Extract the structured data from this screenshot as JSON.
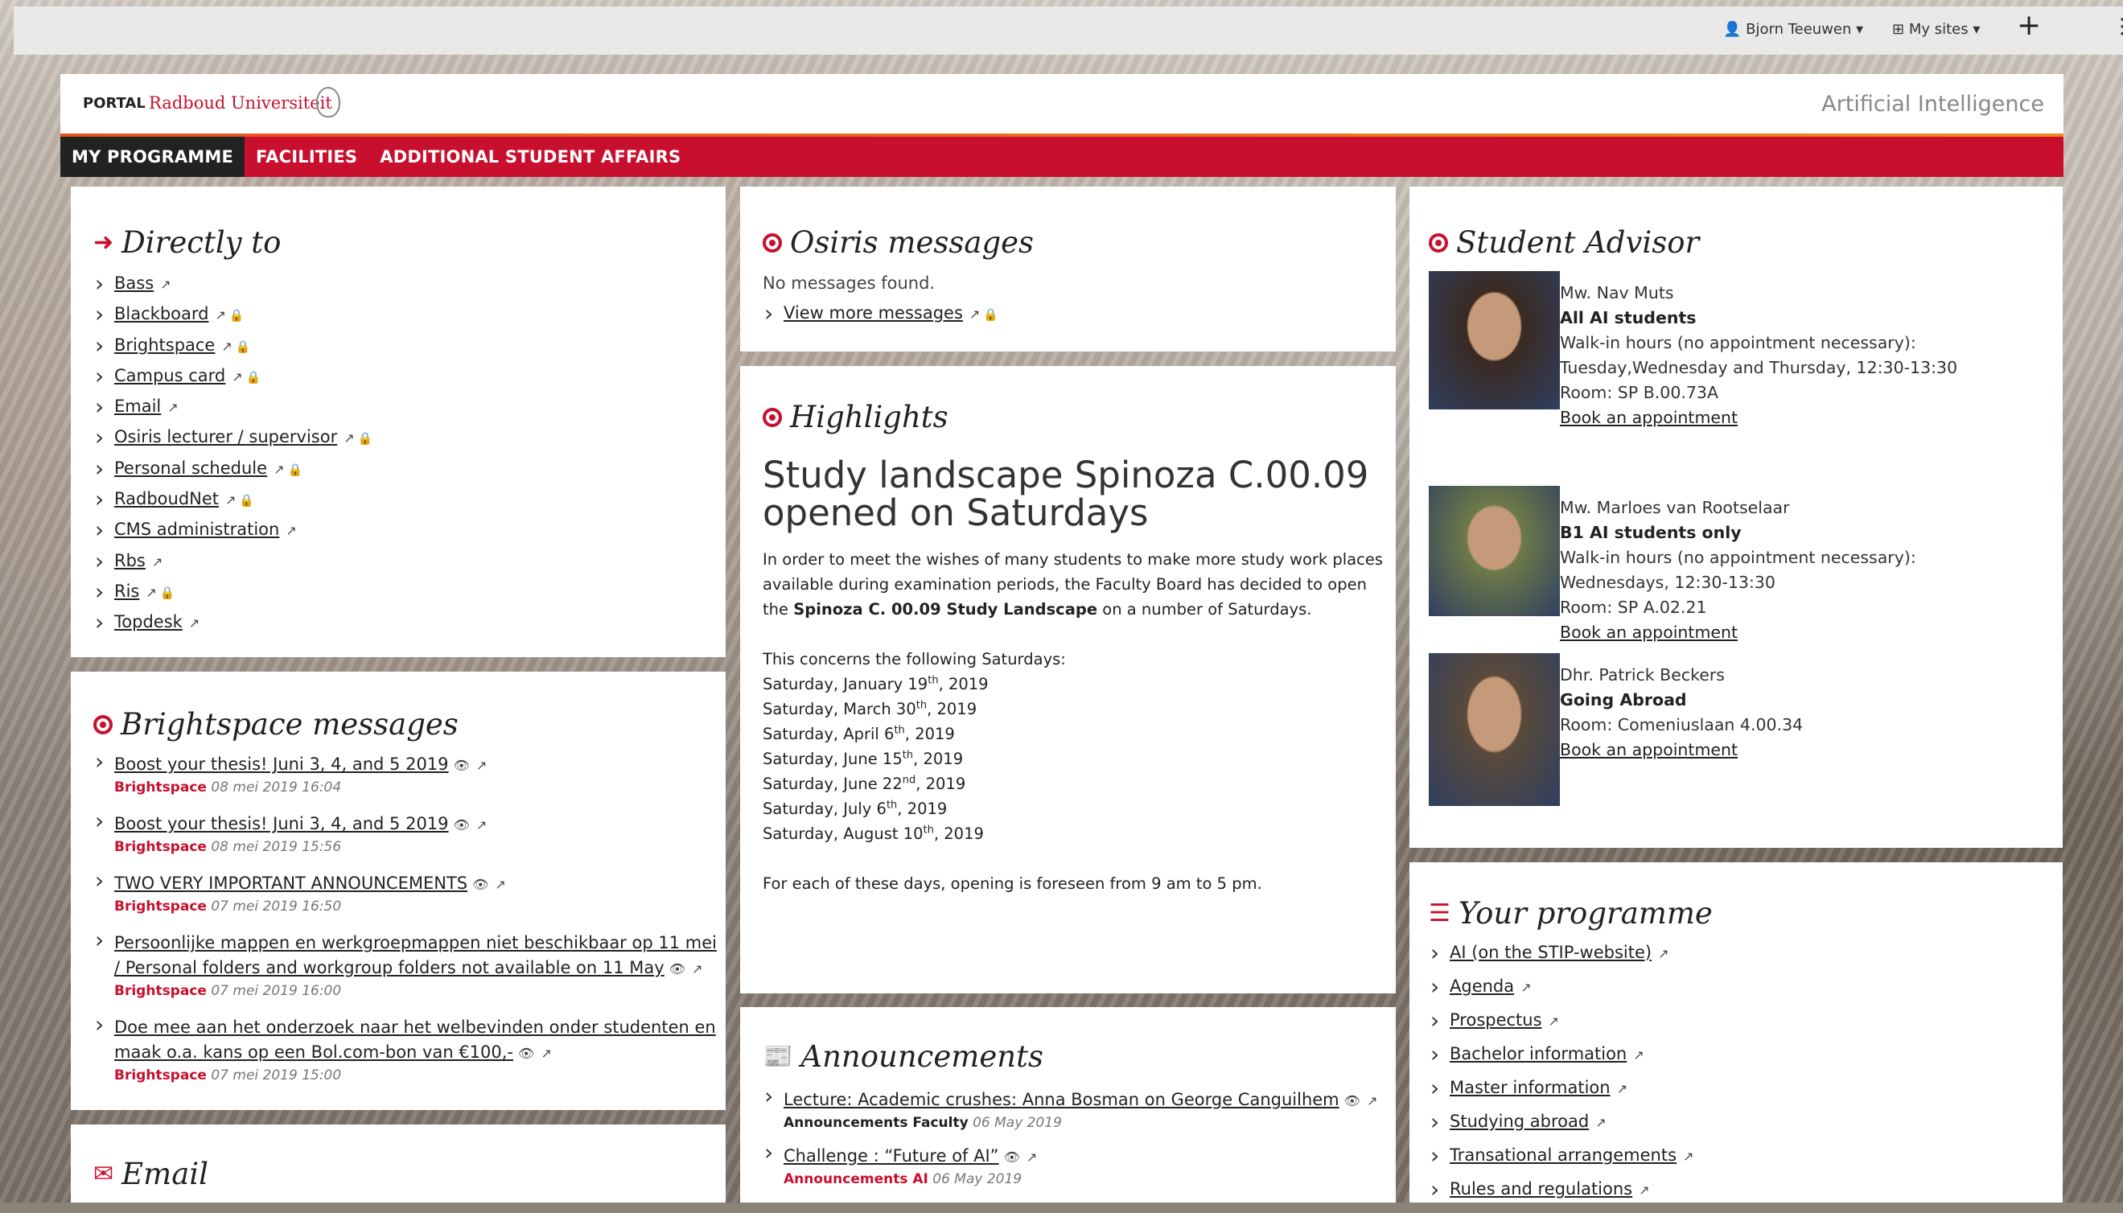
{
  "topbar": {
    "user": "Bjorn Teeuwen",
    "sites": "My sites",
    "add": "+",
    "menu": "⋮"
  },
  "header": {
    "portal": "PORTAL",
    "university": "Radboud Universiteit",
    "programme": "Artificial Intelligence"
  },
  "nav": {
    "items": [
      "MY PROGRAMME",
      "FACILITIES",
      "ADDITIONAL STUDENT AFFAIRS"
    ]
  },
  "directly_to": {
    "title": "Directly to",
    "links": [
      {
        "label": "Bass",
        "lock": false
      },
      {
        "label": "Blackboard",
        "lock": true
      },
      {
        "label": "Brightspace",
        "lock": true
      },
      {
        "label": "Campus card",
        "lock": true
      },
      {
        "label": "Email",
        "lock": false
      },
      {
        "label": "Osiris lecturer / supervisor",
        "lock": true
      },
      {
        "label": "Personal schedule",
        "lock": true
      },
      {
        "label": "RadboudNet",
        "lock": true
      },
      {
        "label": "CMS administration",
        "lock": false
      },
      {
        "label": "Rbs",
        "lock": false
      },
      {
        "label": "Ris",
        "lock": true
      },
      {
        "label": "Topdesk",
        "lock": false
      }
    ]
  },
  "brightspace": {
    "title": "Brightspace messages",
    "items": [
      {
        "line1": "Boost your thesis! Juni 3, 4, and 5 2019",
        "line2": "",
        "source": "Brightspace",
        "date": "08 mei 2019 16:04"
      },
      {
        "line1": "Boost your thesis! Juni 3, 4, and 5 2019",
        "line2": "",
        "source": "Brightspace",
        "date": "08 mei 2019 15:56"
      },
      {
        "line1": "TWO VERY IMPORTANT ANNOUNCEMENTS",
        "line2": "",
        "source": "Brightspace",
        "date": "07 mei 2019 16:50"
      },
      {
        "line1": "Persoonlijke mappen en werkgroepmappen niet beschikbaar op 11 mei",
        "line2": "/ Personal folders and workgroup folders not available on 11 May",
        "source": "Brightspace",
        "date": "07 mei 2019 16:00"
      },
      {
        "line1": "Doe mee aan het onderzoek naar het welbevinden onder studenten en",
        "line2": "maak o.a. kans op een Bol.com-bon van €100,-",
        "source": "Brightspace",
        "date": "07 mei 2019 15:00"
      }
    ]
  },
  "email": {
    "title": "Email"
  },
  "osiris": {
    "title": "Osiris messages",
    "empty": "No messages found.",
    "more": "View more messages"
  },
  "highlights": {
    "title": "Highlights",
    "headline_1": "Study landscape Spinoza C.00.09",
    "headline_2": "opened on Saturdays",
    "para_1": "In order to meet the wishes of many students to make more study work places",
    "para_2": "available during examination periods, the Faculty Board has decided to open",
    "para_3a": "the ",
    "para_3b": "Spinoza C. 00.09 Study Landscape",
    "para_3c": " on a number of Saturdays.",
    "concerns": "This concerns the following Saturdays:",
    "dates": [
      {
        "pre": "Saturday, January 19",
        "sup": "th",
        "post": ", 2019"
      },
      {
        "pre": "Saturday, March 30",
        "sup": "th",
        "post": ", 2019"
      },
      {
        "pre": "Saturday, April 6",
        "sup": "th",
        "post": ", 2019"
      },
      {
        "pre": "Saturday, June 15",
        "sup": "th",
        "post": ", 2019"
      },
      {
        "pre": "Saturday, June 22",
        "sup": "nd",
        "post": ", 2019"
      },
      {
        "pre": "Saturday, July 6",
        "sup": "th",
        "post": ", 2019"
      },
      {
        "pre": "Saturday, August 10",
        "sup": "th",
        "post": ", 2019"
      }
    ],
    "footer": "For each of these days, opening is foreseen from 9 am to 5 pm."
  },
  "announcements": {
    "title": "Announcements",
    "items": [
      {
        "label": "Lecture: Academic crushes: Anna Bosman on George Canguilhem",
        "source": "Announcements Faculty",
        "date": "06 May 2019",
        "source_color": "#222"
      },
      {
        "label": "Challenge : “Future of AI”",
        "source": "Announcements AI",
        "date": "06 May 2019",
        "source_color": "#c8102e"
      }
    ]
  },
  "advisor": {
    "title": "Student Advisor",
    "people": [
      {
        "name": "Mw. Nav Muts",
        "group": "All AI students",
        "l1": "Walk-in hours (no appointment necessary):",
        "l2": "Tuesday,Wednesday and Thursday, 12:30-13:30",
        "room": "Room: SP B.00.73A",
        "book": "Book an appointment"
      },
      {
        "name": "Mw. Marloes van Rootselaar",
        "group": "B1 AI students only",
        "l1": "Walk-in hours (no appointment necessary):",
        "l2": "Wednesdays, 12:30-13:30",
        "room": "Room: SP A.02.21",
        "book": "Book an appointment"
      },
      {
        "name": "Dhr. Patrick Beckers",
        "group": "Going Abroad",
        "l1": "",
        "l2": "",
        "room": "Room: Comeniuslaan 4.00.34",
        "book": "Book an appointment"
      }
    ]
  },
  "programme": {
    "title": "Your programme",
    "links": [
      "AI (on the STIP-website)",
      "Agenda",
      "Prospectus",
      "Bachelor information",
      "Master information",
      "Studying abroad",
      "Transational arrangements",
      "Rules and regulations"
    ]
  },
  "colors": {
    "brand_red": "#c8102e",
    "accent_orange": "#f08a1c",
    "nav_active": "#222222"
  }
}
